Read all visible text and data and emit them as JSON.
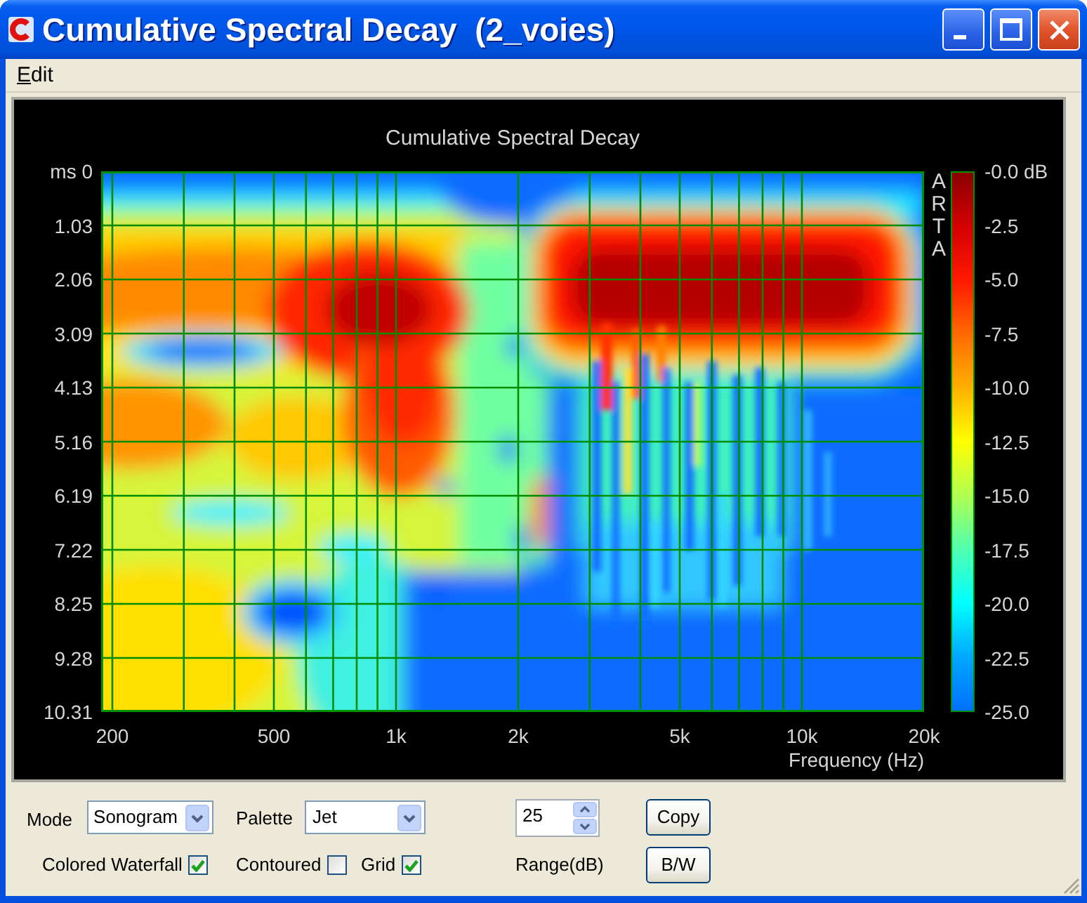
{
  "window": {
    "title": "Cumulative Spectral Decay  (2_voies)"
  },
  "menu": [
    {
      "label": "Edit"
    }
  ],
  "plot": {
    "title": "Cumulative Spectral Decay",
    "y_ticks": [
      "ms 0",
      "1.03",
      "2.06",
      "3.09",
      "4.13",
      "5.16",
      "6.19",
      "7.22",
      "8.25",
      "9.28",
      "10.31"
    ],
    "x_ticks": [
      "200",
      "500",
      "1k",
      "2k",
      "5k",
      "10k",
      "20k"
    ],
    "x_title": "Frequency (Hz)",
    "brand": "ARTA",
    "scale_labels": [
      "-0.0 dB",
      "-2.5",
      "-5.0",
      "-7.5",
      "-10.0",
      "-12.5",
      "-15.0",
      "-17.5",
      "-20.0",
      "-22.5",
      "-25.0"
    ]
  },
  "controls": {
    "mode": {
      "label": "Mode",
      "value": "Sonogram"
    },
    "palette": {
      "label": "Palette",
      "value": "Jet"
    },
    "range": {
      "value": "25",
      "label": "Range(dB)"
    },
    "checkboxes": [
      {
        "label": "Colored Waterfall",
        "checked": true
      },
      {
        "label": "Contoured",
        "checked": false
      },
      {
        "label": "Grid",
        "checked": true
      }
    ],
    "buttons": [
      {
        "label": "Copy"
      },
      {
        "label": "B/W"
      }
    ]
  }
}
